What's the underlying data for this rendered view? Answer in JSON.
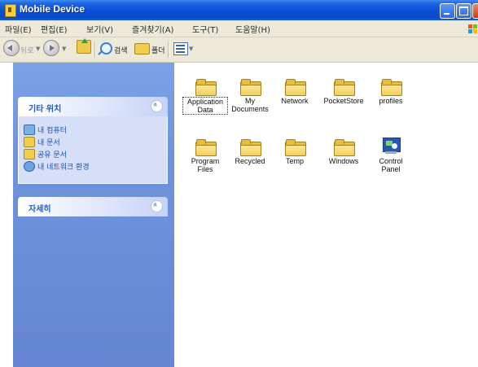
{
  "window": {
    "title": "Mobile Device"
  },
  "menu": {
    "items": [
      "파일(E)",
      "편집(E)",
      "보기(V)",
      "즐겨찾기(A)",
      "도구(T)",
      "도움말(H)"
    ]
  },
  "toolbar": {
    "back_label": "뒤로",
    "search_label": "검색",
    "folders_label": "폴더"
  },
  "sidebar": {
    "other_places": {
      "title": "기타 위치",
      "items": [
        {
          "label": "내 컴퓨터",
          "icon": "computer-icon"
        },
        {
          "label": "내 문서",
          "icon": "documents-icon"
        },
        {
          "label": "공유 문서",
          "icon": "shared-documents-icon"
        },
        {
          "label": "내 네트워크 환경",
          "icon": "network-icon"
        }
      ]
    },
    "details": {
      "title": "자세히"
    }
  },
  "content": {
    "items": [
      {
        "label": "Application\nData",
        "icon": "folder-icon",
        "selected": true
      },
      {
        "label": "My\nDocuments",
        "icon": "folder-icon"
      },
      {
        "label": "Network",
        "icon": "folder-icon"
      },
      {
        "label": "PocketStore",
        "icon": "folder-icon"
      },
      {
        "label": "profiles",
        "icon": "folder-icon"
      },
      {
        "label": "Program\nFiles",
        "icon": "folder-icon"
      },
      {
        "label": "Recycled",
        "icon": "folder-icon"
      },
      {
        "label": "Temp",
        "icon": "folder-icon"
      },
      {
        "label": "Windows",
        "icon": "folder-icon"
      },
      {
        "label": "Control\nPanel",
        "icon": "control-panel-icon"
      }
    ]
  }
}
